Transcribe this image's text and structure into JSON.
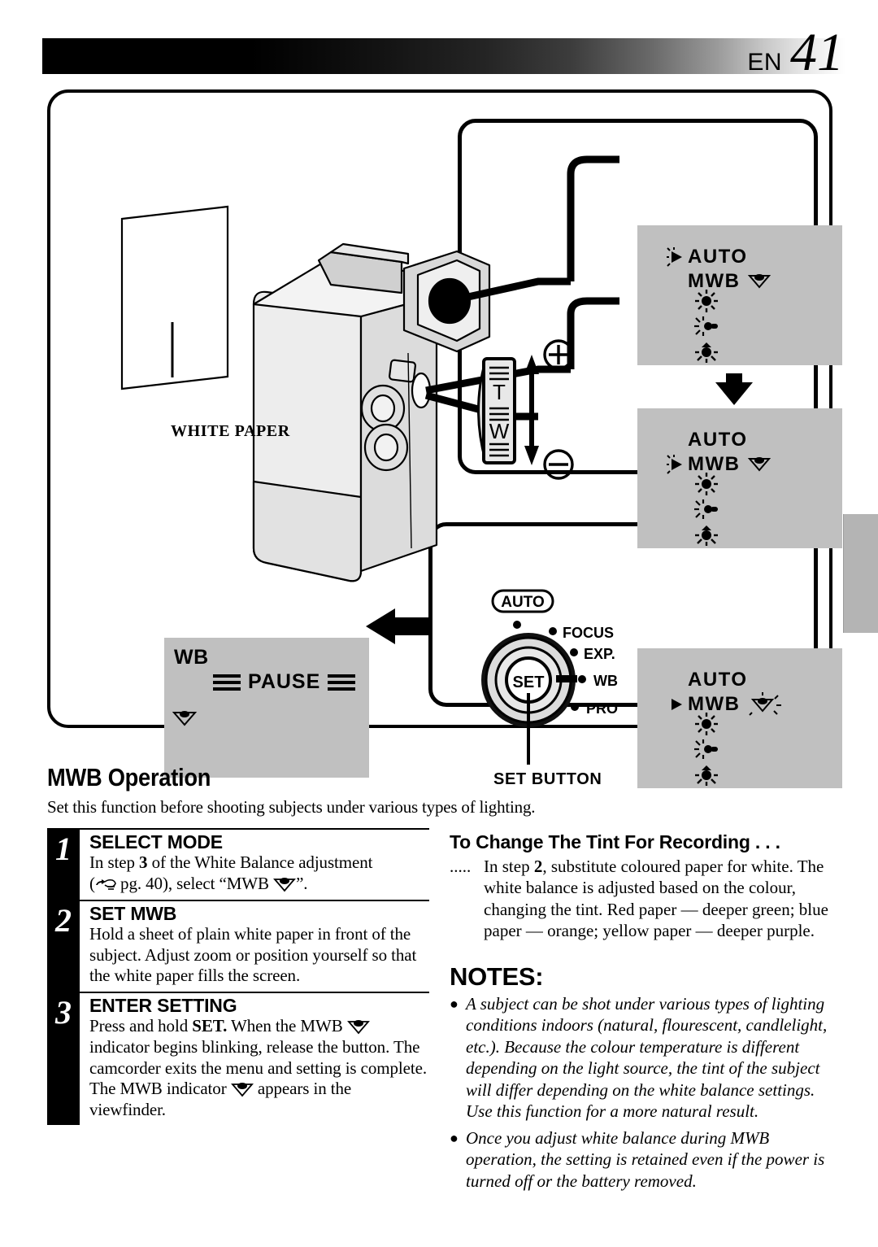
{
  "header": {
    "lang": "EN",
    "page_number": "41"
  },
  "illustration": {
    "paper_label": "WHITE PAPER",
    "set_button_caption": "SET BUTTON",
    "zoom_lever": {
      "tele": "T",
      "wide": "W",
      "plus": "+",
      "minus": "−"
    },
    "dial": {
      "center_label": "SET",
      "auto_label": "AUTO",
      "positions": [
        "FOCUS",
        "EXP.",
        "WB",
        "PRO"
      ]
    },
    "screens": [
      {
        "name": "menu-screen-auto-selected",
        "rows": [
          {
            "label": "AUTO",
            "pointer": "blinking",
            "icon": "none"
          },
          {
            "label": "MWB",
            "pointer": "none",
            "icon": "mwb-paper"
          }
        ],
        "light_icons": [
          "sun-icon",
          "halogen-icon",
          "fluorescent-icon"
        ]
      },
      {
        "name": "menu-screen-mwb-selected",
        "rows": [
          {
            "label": "AUTO",
            "pointer": "none",
            "icon": "none"
          },
          {
            "label": "MWB",
            "pointer": "blinking",
            "icon": "mwb-paper"
          }
        ],
        "light_icons": [
          "sun-icon",
          "halogen-icon",
          "fluorescent-icon"
        ]
      },
      {
        "name": "menu-screen-mwb-blinking-icon",
        "rows": [
          {
            "label": "AUTO",
            "pointer": "none",
            "icon": "none"
          },
          {
            "label": "MWB",
            "pointer": "solid",
            "icon": "mwb-paper-blinking"
          }
        ],
        "light_icons": [
          "sun-icon",
          "halogen-icon",
          "fluorescent-icon"
        ]
      }
    ],
    "wb_screen": {
      "name": "wb-pause-screen",
      "mode_label": "WB",
      "status_label": "PAUSE",
      "indicator_icon": "mwb-paper"
    }
  },
  "body": {
    "section_title": "MWB Operation",
    "section_intro": "Set this function before shooting subjects under various types of lighting.",
    "steps": [
      {
        "number": "1",
        "heading": "SELECT MODE",
        "text_parts": [
          {
            "t": "In step ",
            "b": false
          },
          {
            "t": "3",
            "b": true
          },
          {
            "t": " of the White Balance adjustment",
            "b": false
          }
        ],
        "line2_pre": "(",
        "line2_ref": " pg. 40), select “MWB ",
        "line2_post": "”."
      },
      {
        "number": "2",
        "heading": "SET MWB",
        "text": "Hold a sheet of plain white paper in front of the subject. Adjust zoom or position yourself so that the white paper fills the screen."
      },
      {
        "number": "3",
        "heading": "ENTER SETTING",
        "text_a_pre": "Press and hold ",
        "text_a_bold": "SET.",
        "text_a_post": " When the MWB ",
        "text_b": " indicator begins blinking, release the button. The camcorder exits the menu and setting is complete.",
        "text_c_pre": "The MWB indicator ",
        "text_c_post": " appears in the viewfinder."
      }
    ],
    "right_column": {
      "tint_title": "To Change The Tint For Recording . . .",
      "tint_dots": ".....",
      "tint_body_pre": "In step ",
      "tint_body_bold": "2",
      "tint_body_post": ", substitute coloured paper for white. The white balance is adjusted based on the colour, changing the tint. Red paper — deeper green; blue paper — orange; yellow paper — deeper purple.",
      "notes_title": "NOTES:",
      "notes": [
        "A subject can be shot under various types of lighting conditions indoors (natural, flourescent, candlelight, etc.). Because the colour temperature is different depending on the light source, the tint of the subject will differ depending on the white balance settings. Use this function for a more natural result.",
        "Once you adjust white balance during MWB operation, the setting is retained even if the power is turned off or the battery removed."
      ]
    }
  },
  "colors": {
    "lcd_background": "#c0c0c0",
    "edge_tab": "#b4b4b4",
    "ink": "#000000"
  }
}
